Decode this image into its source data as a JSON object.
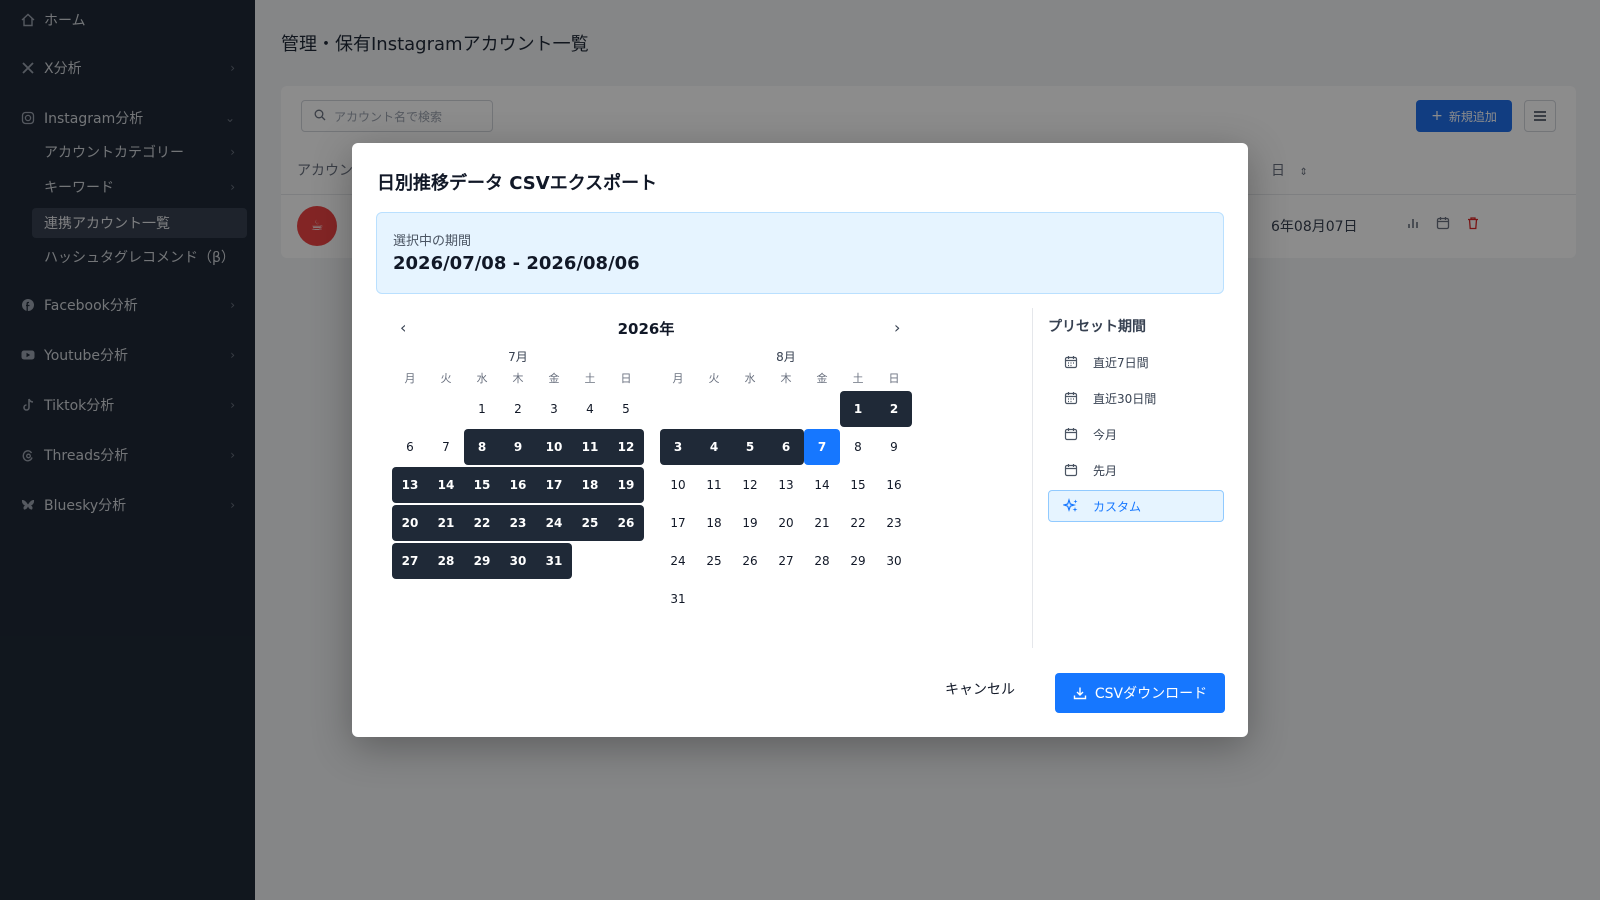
{
  "sidebar": {
    "items": [
      {
        "label": "ホーム",
        "icon": "home-icon"
      },
      {
        "label": "X分析",
        "icon": "x-logo-icon"
      },
      {
        "label": "Instagram分析",
        "icon": "instagram-icon"
      },
      {
        "label": "Facebook分析",
        "icon": "facebook-icon"
      },
      {
        "label": "Youtube分析",
        "icon": "youtube-icon"
      },
      {
        "label": "Tiktok分析",
        "icon": "tiktok-icon"
      },
      {
        "label": "Threads分析",
        "icon": "threads-icon"
      },
      {
        "label": "Bluesky分析",
        "icon": "bluesky-icon"
      }
    ],
    "sub_items": [
      {
        "label": "アカウントカテゴリー"
      },
      {
        "label": "キーワード"
      },
      {
        "label": "連携アカウント一覧"
      },
      {
        "label": "ハッシュタグレコメンド（β）"
      }
    ]
  },
  "main": {
    "page_title": "管理・保有Instagramアカウント一覧",
    "search_placeholder": "アカウント名で検索",
    "add_button": "新規追加",
    "col_account": "アカウン",
    "col_date": "日",
    "row_avatar": "☕",
    "row_date": "6年08月07日"
  },
  "modal": {
    "title": "日別推移データ CSVエクスポート",
    "period_label": "選択中の期間",
    "period_value": "2026/07/08 - 2026/08/06",
    "year_label": "2026年",
    "weekdays": [
      "月",
      "火",
      "水",
      "木",
      "金",
      "土",
      "日"
    ],
    "months": [
      {
        "label": "7月",
        "offset": 2,
        "days": 31,
        "range_start": 8,
        "range_end": 31,
        "today": null
      },
      {
        "label": "8月",
        "offset": 5,
        "days": 31,
        "range_start": 1,
        "range_end": 6,
        "today": 7
      }
    ],
    "presets_title": "プリセット期間",
    "presets": [
      {
        "label": "直近7日間",
        "icon": "calendar-icon",
        "active": false
      },
      {
        "label": "直近30日間",
        "icon": "calendar-icon",
        "active": false
      },
      {
        "label": "今月",
        "icon": "calendar-icon",
        "active": false
      },
      {
        "label": "先月",
        "icon": "calendar-icon",
        "active": false
      },
      {
        "label": "カスタム",
        "icon": "sparkles-icon",
        "active": true
      }
    ],
    "cancel_label": "キャンセル",
    "download_label": "CSVダウンロード"
  }
}
